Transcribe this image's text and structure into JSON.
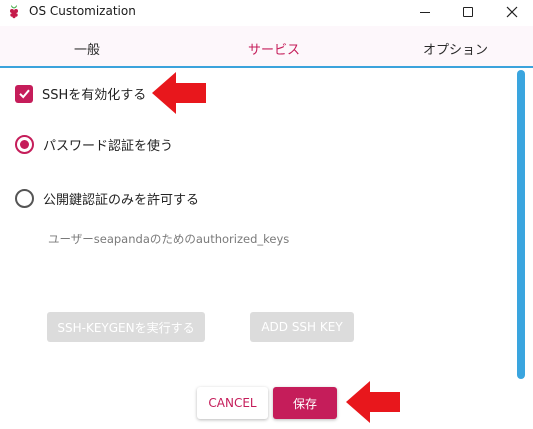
{
  "window": {
    "title": "OS Customization",
    "icon": "raspberry-pi-icon"
  },
  "tabs": [
    {
      "label": "一般",
      "selected": false
    },
    {
      "label": "サービス",
      "selected": true
    },
    {
      "label": "オプション",
      "selected": false
    }
  ],
  "ssh": {
    "enable_label": "SSHを有効化する",
    "enable_checked": true,
    "password_auth_label": "パスワード認証を使う",
    "password_auth_selected": true,
    "pubkey_label": "公開鍵認証のみを許可する",
    "pubkey_selected": false,
    "authorized_keys_label": "ユーザーseapandaのためのauthorized_keys",
    "keygen_button": "SSH-KEYGENを実行する",
    "add_key_button": "ADD SSH KEY"
  },
  "footer": {
    "cancel_label": "CANCEL",
    "save_label": "保存"
  },
  "colors": {
    "accent": "#c51d5a",
    "tab_underline": "#3ba3dc",
    "scrollbar": "#3aa5df",
    "annotation_arrow": "#e8171c"
  }
}
